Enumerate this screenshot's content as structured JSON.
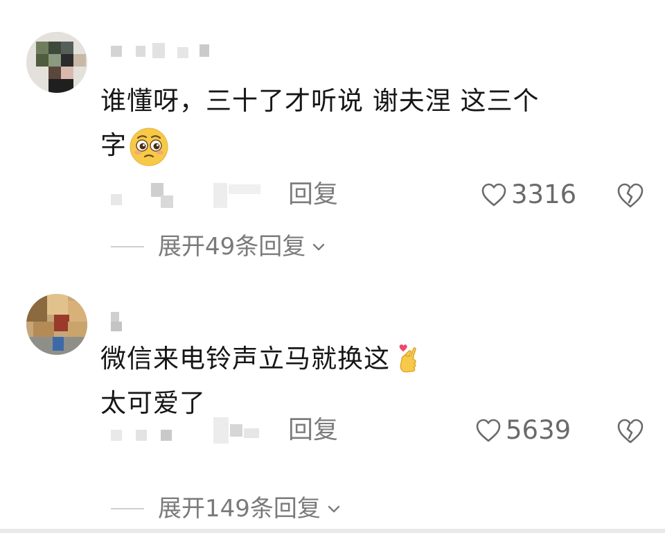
{
  "comments": [
    {
      "text_line1": "谁懂呀，三十了才听说 谢夫涅 这三个",
      "text_line2": "字",
      "emoji": "pleading-face-icon",
      "reply_label": "回复",
      "likes": "3316",
      "expand_label": "展开49条回复"
    },
    {
      "text_line1": "微信来电铃声立马就换这",
      "text_line2": "太可爱了",
      "emoji": "finger-heart-icon",
      "reply_label": "回复",
      "likes": "5639",
      "expand_label": "展开149条回复"
    }
  ],
  "colors": {
    "text": "#161616",
    "muted": "#7c7c7c",
    "divider": "#cfcfcf",
    "heart_pink": "#f0476a",
    "emoji_yellow": "#f7c948"
  }
}
